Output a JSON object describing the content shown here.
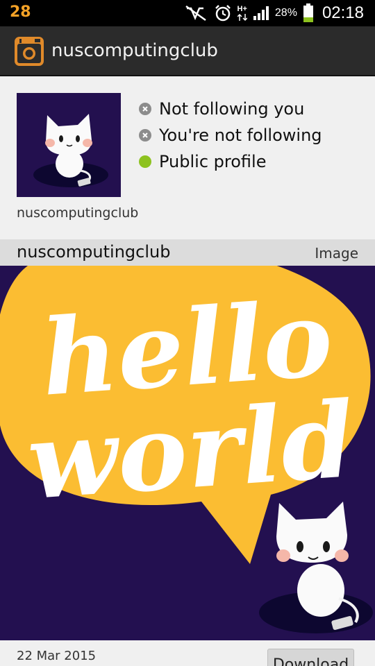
{
  "status_bar": {
    "notification_count": "28",
    "network_label": "H+",
    "battery_percent": "28%",
    "time": "02:18",
    "icons": [
      "mute-icon",
      "alarm-icon",
      "network-arrows-icon",
      "signal-icon",
      "battery-icon"
    ]
  },
  "action_bar": {
    "app_icon": "instagram-camera-icon",
    "title": "nuscomputingclub"
  },
  "profile": {
    "username": "nuscomputingclub",
    "statuses": [
      {
        "label": "Not following you",
        "state": "no"
      },
      {
        "label": "You're not following",
        "state": "no"
      },
      {
        "label": "Public profile",
        "state": "yes"
      }
    ]
  },
  "post": {
    "username": "nuscomputingclub",
    "type": "Image",
    "image_text_line1": "hello",
    "image_text_line2": "world",
    "date": "22 Mar 2015",
    "download_label": "Download"
  },
  "colors": {
    "accent_orange": "#f4a227",
    "image_background": "#231050",
    "speech_bubble": "#fbbd32",
    "status_green": "#8dc21f",
    "status_grey": "#8c8c8c"
  }
}
